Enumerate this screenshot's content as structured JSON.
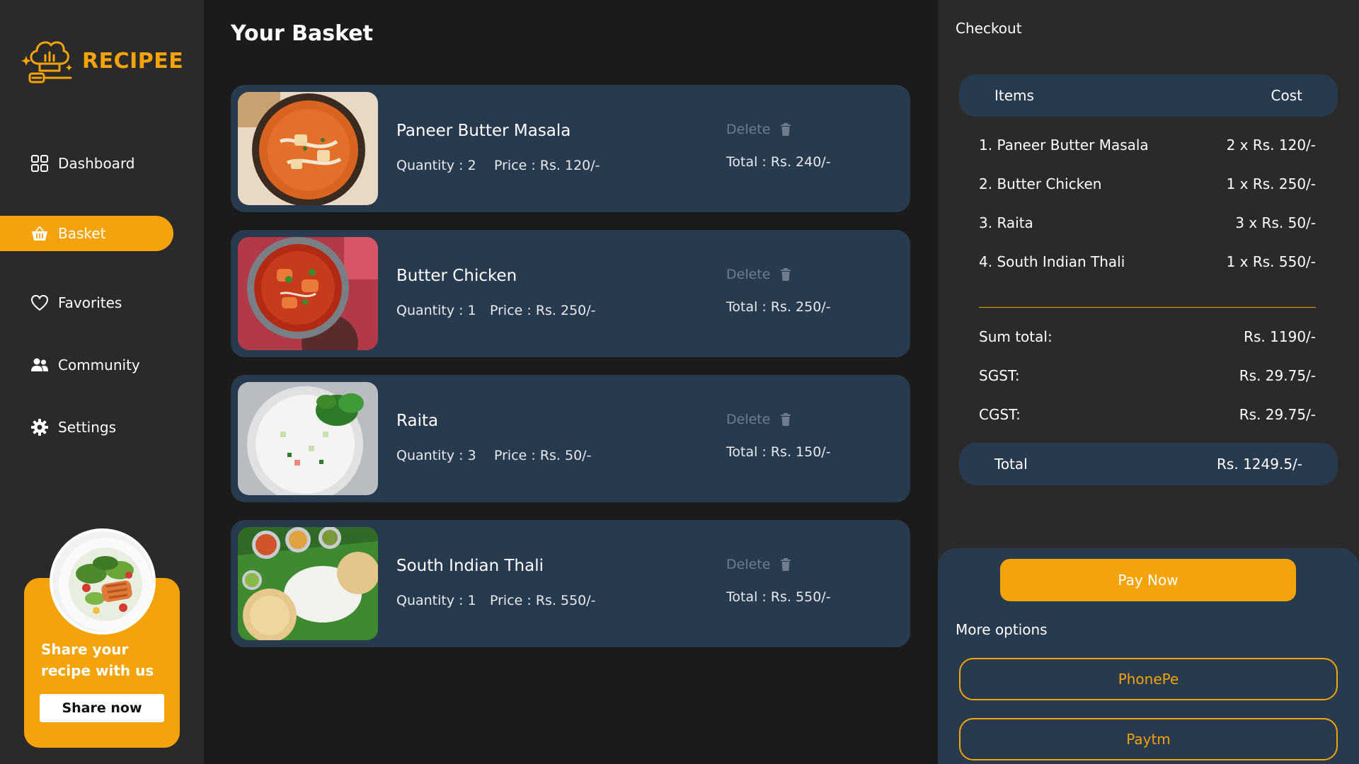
{
  "app": {
    "name": "RECIPEE",
    "brand_color": "#f5a30a"
  },
  "sidebar": {
    "items": [
      {
        "label": "Dashboard",
        "icon": "grid-icon",
        "active": false
      },
      {
        "label": "Basket",
        "icon": "basket-icon",
        "active": true
      },
      {
        "label": "Favorites",
        "icon": "heart-icon",
        "active": false
      },
      {
        "label": "Community",
        "icon": "users-icon",
        "active": false
      },
      {
        "label": "Settings",
        "icon": "gear-icon",
        "active": false
      }
    ],
    "promo": {
      "text": "Share your recipe with us",
      "button": "Share now"
    }
  },
  "basket": {
    "title": "Your Basket",
    "items": [
      {
        "name": "Paneer Butter Masala",
        "quantity": "Quantity : 2",
        "price": "Price : Rs. 120/-",
        "total": "Total : Rs. 240/-",
        "delete": "Delete"
      },
      {
        "name": "Butter Chicken",
        "quantity": "Quantity : 1",
        "price": "Price : Rs. 250/-",
        "total": "Total : Rs. 250/-",
        "delete": "Delete"
      },
      {
        "name": "Raita",
        "quantity": "Quantity : 3",
        "price": "Price : Rs. 50/-",
        "total": "Total : Rs. 150/-",
        "delete": "Delete"
      },
      {
        "name": "South Indian Thali",
        "quantity": "Quantity : 1",
        "price": "Price : Rs. 550/-",
        "total": "Total : Rs. 550/-",
        "delete": "Delete"
      }
    ]
  },
  "checkout": {
    "title": "Checkout",
    "header": {
      "items": "Items",
      "cost": "Cost"
    },
    "lines": [
      {
        "item": "1. Paneer Butter Masala",
        "cost": "2 x Rs. 120/-"
      },
      {
        "item": "2. Butter Chicken",
        "cost": "1 x Rs. 250/-"
      },
      {
        "item": "3. Raita",
        "cost": "3 x Rs. 50/-"
      },
      {
        "item": "4. South Indian Thali",
        "cost": "1 x Rs. 550/-"
      }
    ],
    "sum_total": {
      "label": "Sum total:",
      "value": "Rs. 1190/-"
    },
    "sgst": {
      "label": "SGST:",
      "value": "Rs. 29.75/-"
    },
    "cgst": {
      "label": "CGST:",
      "value": "Rs. 29.75/-"
    },
    "total": {
      "label": "Total",
      "value": "Rs. 1249.5/-"
    },
    "pay_now": "Pay Now",
    "more_options": "More options",
    "options": [
      "PhonePe",
      "Paytm"
    ]
  }
}
